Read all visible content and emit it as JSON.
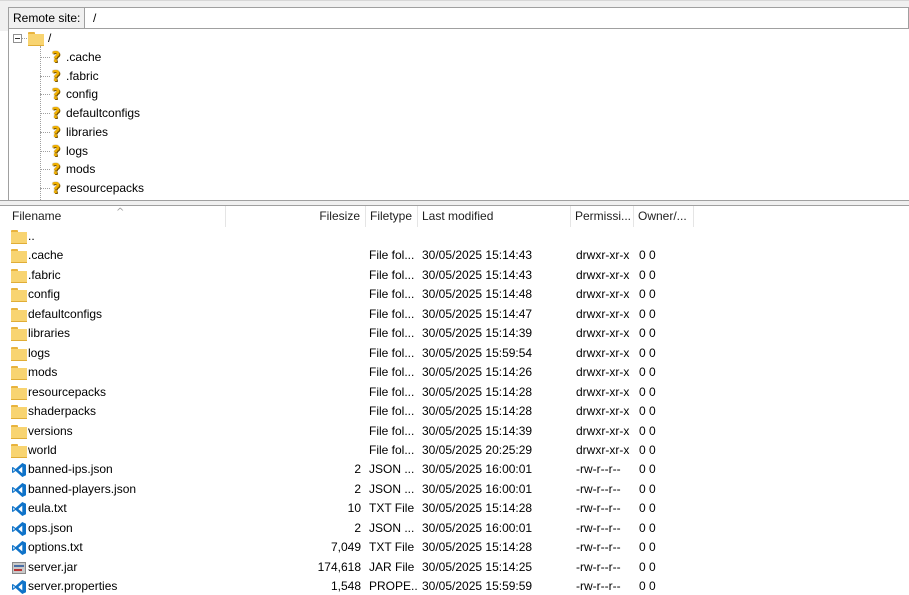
{
  "remote_site": {
    "label": "Remote site:",
    "path": "/"
  },
  "tree": {
    "root": "/",
    "items": [
      {
        "label": ".cache",
        "icon": "question-folder-icon"
      },
      {
        "label": ".fabric",
        "icon": "question-folder-icon"
      },
      {
        "label": "config",
        "icon": "question-folder-icon"
      },
      {
        "label": "defaultconfigs",
        "icon": "question-folder-icon"
      },
      {
        "label": "libraries",
        "icon": "question-folder-icon"
      },
      {
        "label": "logs",
        "icon": "question-folder-icon"
      },
      {
        "label": "mods",
        "icon": "question-folder-icon"
      },
      {
        "label": "resourcepacks",
        "icon": "question-folder-icon"
      }
    ]
  },
  "columns": {
    "filename": "Filename",
    "filesize": "Filesize",
    "filetype": "Filetype",
    "modified": "Last modified",
    "permissions": "Permissi...",
    "owner": "Owner/..."
  },
  "files": [
    {
      "name": "..",
      "size": "",
      "type": "",
      "modified": "",
      "perm": "",
      "owner": "",
      "icon": "folder-icon"
    },
    {
      "name": ".cache",
      "size": "",
      "type": "File fol...",
      "modified": "30/05/2025 15:14:43",
      "perm": "drwxr-xr-x",
      "owner": "0 0",
      "icon": "folder-icon"
    },
    {
      "name": ".fabric",
      "size": "",
      "type": "File fol...",
      "modified": "30/05/2025 15:14:43",
      "perm": "drwxr-xr-x",
      "owner": "0 0",
      "icon": "folder-icon"
    },
    {
      "name": "config",
      "size": "",
      "type": "File fol...",
      "modified": "30/05/2025 15:14:48",
      "perm": "drwxr-xr-x",
      "owner": "0 0",
      "icon": "folder-icon"
    },
    {
      "name": "defaultconfigs",
      "size": "",
      "type": "File fol...",
      "modified": "30/05/2025 15:14:47",
      "perm": "drwxr-xr-x",
      "owner": "0 0",
      "icon": "folder-icon"
    },
    {
      "name": "libraries",
      "size": "",
      "type": "File fol...",
      "modified": "30/05/2025 15:14:39",
      "perm": "drwxr-xr-x",
      "owner": "0 0",
      "icon": "folder-icon"
    },
    {
      "name": "logs",
      "size": "",
      "type": "File fol...",
      "modified": "30/05/2025 15:59:54",
      "perm": "drwxr-xr-x",
      "owner": "0 0",
      "icon": "folder-icon"
    },
    {
      "name": "mods",
      "size": "",
      "type": "File fol...",
      "modified": "30/05/2025 15:14:26",
      "perm": "drwxr-xr-x",
      "owner": "0 0",
      "icon": "folder-icon"
    },
    {
      "name": "resourcepacks",
      "size": "",
      "type": "File fol...",
      "modified": "30/05/2025 15:14:28",
      "perm": "drwxr-xr-x",
      "owner": "0 0",
      "icon": "folder-icon"
    },
    {
      "name": "shaderpacks",
      "size": "",
      "type": "File fol...",
      "modified": "30/05/2025 15:14:28",
      "perm": "drwxr-xr-x",
      "owner": "0 0",
      "icon": "folder-icon"
    },
    {
      "name": "versions",
      "size": "",
      "type": "File fol...",
      "modified": "30/05/2025 15:14:39",
      "perm": "drwxr-xr-x",
      "owner": "0 0",
      "icon": "folder-icon"
    },
    {
      "name": "world",
      "size": "",
      "type": "File fol...",
      "modified": "30/05/2025 20:25:29",
      "perm": "drwxr-xr-x",
      "owner": "0 0",
      "icon": "folder-icon"
    },
    {
      "name": "banned-ips.json",
      "size": "2",
      "type": "JSON ...",
      "modified": "30/05/2025 16:00:01",
      "perm": "-rw-r--r--",
      "owner": "0 0",
      "icon": "vscode-icon"
    },
    {
      "name": "banned-players.json",
      "size": "2",
      "type": "JSON ...",
      "modified": "30/05/2025 16:00:01",
      "perm": "-rw-r--r--",
      "owner": "0 0",
      "icon": "vscode-icon"
    },
    {
      "name": "eula.txt",
      "size": "10",
      "type": "TXT File",
      "modified": "30/05/2025 15:14:28",
      "perm": "-rw-r--r--",
      "owner": "0 0",
      "icon": "vscode-icon"
    },
    {
      "name": "ops.json",
      "size": "2",
      "type": "JSON ...",
      "modified": "30/05/2025 16:00:01",
      "perm": "-rw-r--r--",
      "owner": "0 0",
      "icon": "vscode-icon"
    },
    {
      "name": "options.txt",
      "size": "7,049",
      "type": "TXT File",
      "modified": "30/05/2025 15:14:28",
      "perm": "-rw-r--r--",
      "owner": "0 0",
      "icon": "vscode-icon"
    },
    {
      "name": "server.jar",
      "size": "174,618",
      "type": "JAR File",
      "modified": "30/05/2025 15:14:25",
      "perm": "-rw-r--r--",
      "owner": "0 0",
      "icon": "jar-icon"
    },
    {
      "name": "server.properties",
      "size": "1,548",
      "type": "PROPE...",
      "modified": "30/05/2025 15:59:59",
      "perm": "-rw-r--r--",
      "owner": "0 0",
      "icon": "vscode-icon"
    }
  ],
  "colors": {
    "folder": "#f8d471",
    "vscode": "#0f73c9",
    "question": "#f2b100"
  }
}
